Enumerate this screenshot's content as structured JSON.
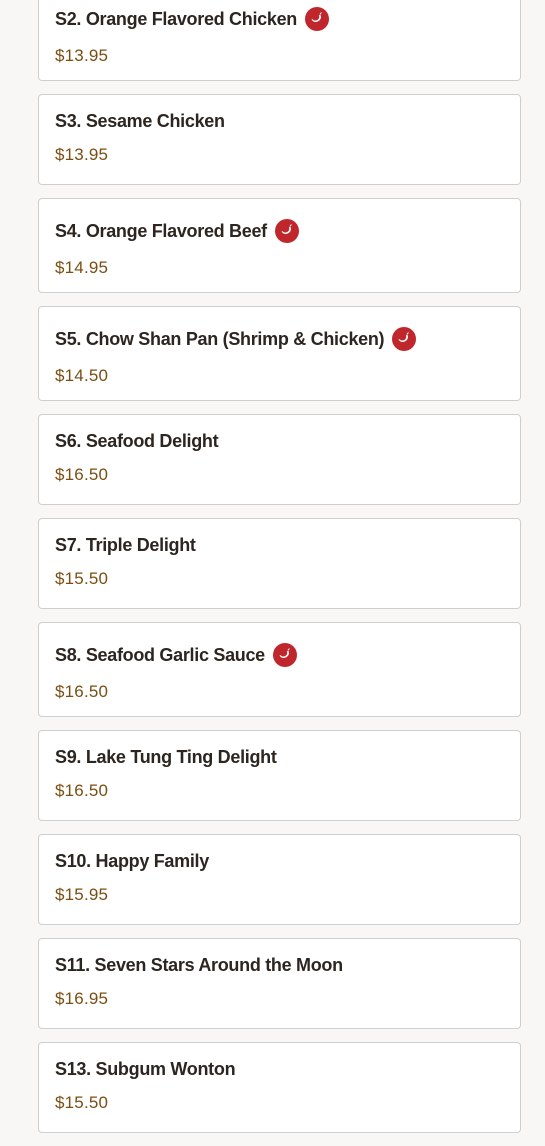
{
  "colors": {
    "background": "#f8f7f5",
    "card": "#ffffff",
    "border": "#cfcfcf",
    "name_text": "#2d2520",
    "price_text": "#7a4e12",
    "spicy_icon": "#c0272d"
  },
  "menu": {
    "items": [
      {
        "name": "S2. Orange Flavored Chicken",
        "price": "$13.95",
        "spicy": true,
        "icon": "chili-pepper-icon"
      },
      {
        "name": "S3. Sesame Chicken",
        "price": "$13.95",
        "spicy": false
      },
      {
        "name": "S4. Orange Flavored Beef",
        "price": "$14.95",
        "spicy": true,
        "icon": "chili-pepper-icon"
      },
      {
        "name": "S5. Chow Shan Pan (Shrimp & Chicken)",
        "price": "$14.50",
        "spicy": true,
        "icon": "chili-pepper-icon"
      },
      {
        "name": "S6. Seafood Delight",
        "price": "$16.50",
        "spicy": false
      },
      {
        "name": "S7. Triple Delight",
        "price": "$15.50",
        "spicy": false
      },
      {
        "name": "S8. Seafood Garlic Sauce",
        "price": "$16.50",
        "spicy": true,
        "icon": "chili-pepper-icon"
      },
      {
        "name": "S9. Lake Tung Ting Delight",
        "price": "$16.50",
        "spicy": false
      },
      {
        "name": "S10. Happy Family",
        "price": "$15.95",
        "spicy": false
      },
      {
        "name": "S11. Seven Stars Around the Moon",
        "price": "$16.95",
        "spicy": false
      },
      {
        "name": "S13. Subgum Wonton",
        "price": "$15.50",
        "spicy": false
      }
    ]
  }
}
